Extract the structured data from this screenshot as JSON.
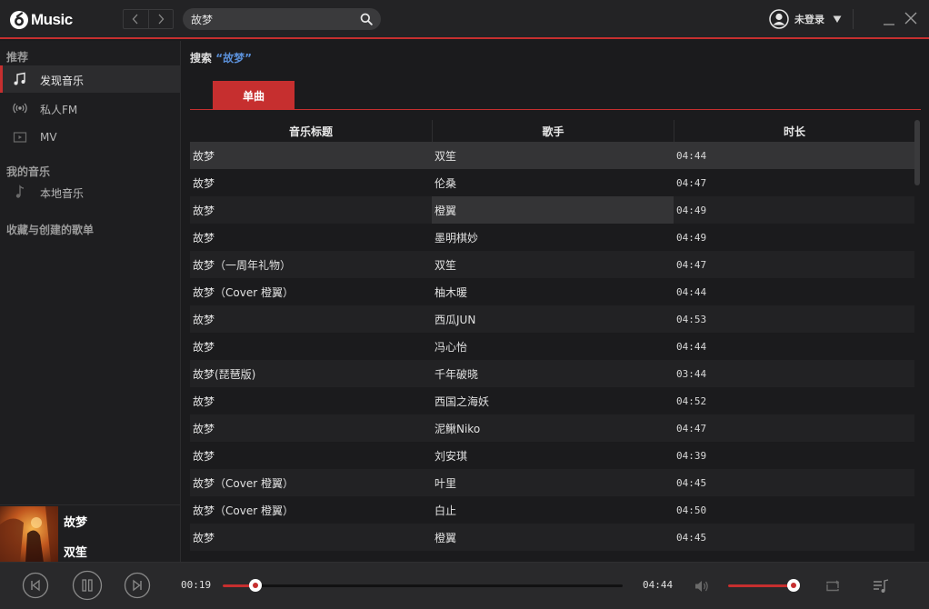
{
  "app": {
    "logo_text": "Music"
  },
  "search": {
    "value": "故梦",
    "placeholder": ""
  },
  "user": {
    "name": "未登录"
  },
  "sidebar": {
    "sections": [
      {
        "title": "推荐"
      },
      {
        "title": "我的音乐"
      },
      {
        "title": "收藏与创建的歌单"
      }
    ],
    "items": [
      {
        "label": "发现音乐",
        "icon": "music-note-icon",
        "active": true
      },
      {
        "label": "私人FM",
        "icon": "radio-icon"
      },
      {
        "label": "MV",
        "icon": "video-icon"
      },
      {
        "label": "本地音乐",
        "icon": "music-note-icon"
      }
    ]
  },
  "now_playing": {
    "title": "故梦",
    "artist": "双笙"
  },
  "main": {
    "search_prefix": "搜索",
    "search_keyword": "“故梦”",
    "tabs": [
      {
        "label": "单曲",
        "active": true
      }
    ],
    "columns": [
      "音乐标题",
      "歌手",
      "时长"
    ],
    "rows": [
      {
        "title": "故梦",
        "artist": "双笙",
        "duration": "04:44"
      },
      {
        "title": "故梦",
        "artist": "伦桑",
        "duration": "04:47"
      },
      {
        "title": "故梦",
        "artist": "橙翼",
        "duration": "04:49"
      },
      {
        "title": "故梦",
        "artist": "墨明棋妙",
        "duration": "04:49"
      },
      {
        "title": "故梦（一周年礼物）",
        "artist": "双笙",
        "duration": "04:47"
      },
      {
        "title": "故梦（Cover 橙翼）",
        "artist": "柚木暖",
        "duration": "04:44"
      },
      {
        "title": "故梦",
        "artist": "西瓜JUN",
        "duration": "04:53"
      },
      {
        "title": "故梦",
        "artist": "冯心怡",
        "duration": "04:44"
      },
      {
        "title": "故梦(琵琶版)",
        "artist": "千年破晓",
        "duration": "03:44"
      },
      {
        "title": "故梦",
        "artist": "西国之海妖",
        "duration": "04:52"
      },
      {
        "title": "故梦",
        "artist": "泥鳅Niko",
        "duration": "04:47"
      },
      {
        "title": "故梦",
        "artist": "刘安琪",
        "duration": "04:39"
      },
      {
        "title": "故梦（Cover 橙翼）",
        "artist": "叶里",
        "duration": "04:45"
      },
      {
        "title": "故梦（Cover 橙翼）",
        "artist": "白止",
        "duration": "04:50"
      },
      {
        "title": "故梦",
        "artist": "橙翼",
        "duration": "04:45"
      }
    ]
  },
  "player": {
    "current_time": "00:19",
    "total_time": "04:44",
    "progress_fraction": 0.082,
    "volume_fraction": 0.97
  },
  "colors": {
    "accent": "#c62f2f",
    "keyword": "#5a8fd8",
    "background": "#1b1b1d"
  }
}
